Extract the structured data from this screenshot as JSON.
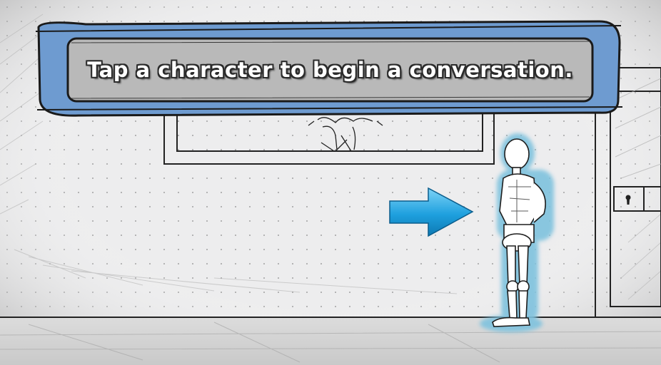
{
  "dialog": {
    "message": "Tap a character to begin a conversation."
  },
  "scene": {
    "characters": [
      {
        "name": "mannequin-character",
        "highlight_color": "#7fc2de"
      }
    ],
    "arrow": {
      "icon": "arrow-right-icon",
      "color": "#2aa6e0"
    }
  },
  "colors": {
    "dialog_frame": "#6e9bd0",
    "dialog_panel": "#b9b9b9",
    "paper": "#ededee",
    "ink": "#1f1f1f"
  }
}
